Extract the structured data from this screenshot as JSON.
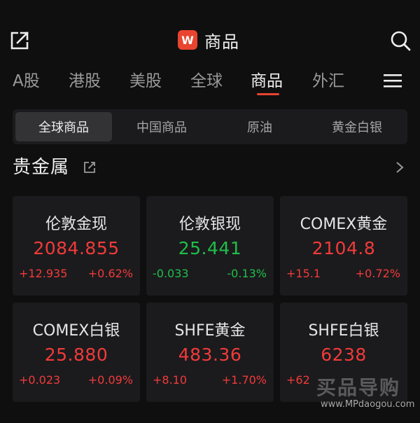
{
  "header": {
    "logo_text": "W",
    "title": "商品",
    "icons": {
      "left": "share-icon",
      "right": "search-icon"
    }
  },
  "nav": {
    "tabs": [
      "A股",
      "港股",
      "美股",
      "全球",
      "商品",
      "外汇"
    ],
    "active": "商品",
    "menu_icon": "menu-icon"
  },
  "segment": {
    "tabs": [
      "全球商品",
      "中国商品",
      "原油",
      "黄金白银"
    ],
    "active": "全球商品"
  },
  "section": {
    "title": "贵金属",
    "icons": [
      "external-link-icon",
      "chevron-right-icon"
    ]
  },
  "cards": [
    {
      "name": "伦敦金现",
      "price": "2084.855",
      "change": "+12.935",
      "percent": "+0.62%",
      "trend": "up"
    },
    {
      "name": "伦敦银现",
      "price": "25.441",
      "change": "-0.033",
      "percent": "-0.13%",
      "trend": "down"
    },
    {
      "name": "COMEX黄金",
      "price": "2104.8",
      "change": "+15.1",
      "percent": "+0.72%",
      "trend": "up"
    },
    {
      "name": "COMEX白银",
      "price": "25.880",
      "change": "+0.023",
      "percent": "+0.09%",
      "trend": "up"
    },
    {
      "name": "SHFE黄金",
      "price": "483.36",
      "change": "+8.10",
      "percent": "+1.70%",
      "trend": "up"
    },
    {
      "name": "SHFE白银",
      "price": "6238",
      "change": "+62",
      "percent": "",
      "trend": "up"
    }
  ],
  "watermark": {
    "big": "买品导购",
    "small": "www.MPdaogou.com"
  },
  "colors": {
    "up": "#f23a3a",
    "down": "#1fbf4a",
    "accent": "#e8442f",
    "background": "#0f0f10",
    "card": "#1b1b1d"
  }
}
